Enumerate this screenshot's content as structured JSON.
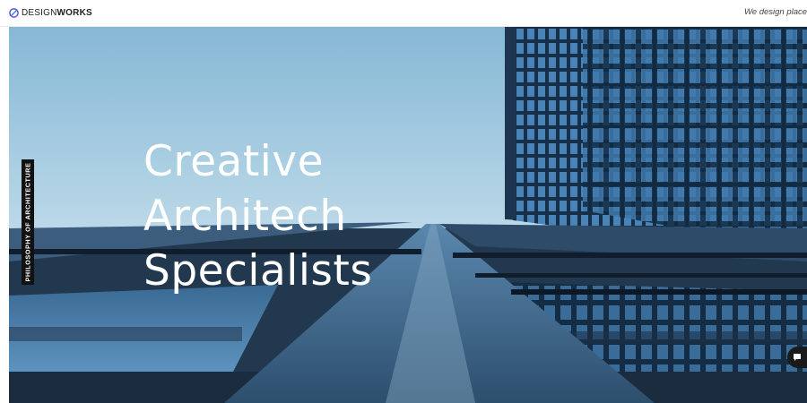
{
  "header": {
    "logo_light": "DESIGN",
    "logo_bold": "WORKS",
    "tagline": "We design places"
  },
  "hero": {
    "title_lines": [
      "Creative",
      "Architech",
      "Specialists"
    ],
    "vertical_tab_label": "PHILOSOPHY OF ARCHITECTURE"
  },
  "icons": {
    "logo": "logo-mark-icon",
    "chat": "chat-bubble-icon"
  },
  "colors": {
    "sky": "#a6cbe0",
    "building_glass": "#3d6d94",
    "title_text": "#ffffff",
    "tab_background": "#111111"
  }
}
